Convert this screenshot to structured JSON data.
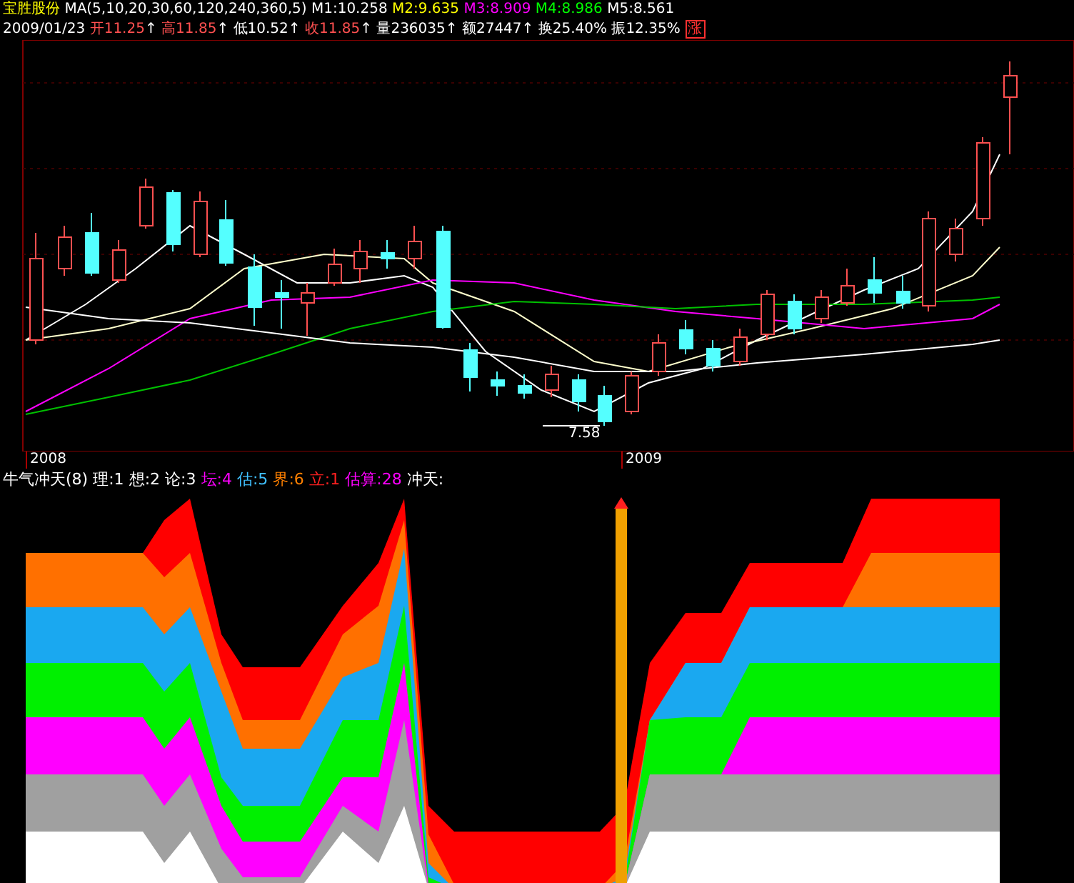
{
  "header": {
    "stock_name": "宝胜股份",
    "ma_params": "MA(5,10,20,30,60,120,240,360,5)",
    "ma_values": [
      {
        "label": "M1:10.258",
        "color": "#ffffff"
      },
      {
        "label": "M2:9.635",
        "color": "#ffff00"
      },
      {
        "label": "M3:8.909",
        "color": "#ff00ff"
      },
      {
        "label": "M4:8.986",
        "color": "#00ff00"
      },
      {
        "label": "M5:8.561",
        "color": "#ffffff"
      }
    ]
  },
  "quote": {
    "date": "2009/01/23",
    "fields": [
      {
        "label": "开11.25",
        "arrow": "↑",
        "color": "#ff5050"
      },
      {
        "label": "高11.85",
        "arrow": "↑",
        "color": "#ff5050"
      },
      {
        "label": "低10.52",
        "arrow": "↑",
        "color": "#ffffff"
      },
      {
        "label": "收11.85",
        "arrow": "↑",
        "color": "#ff5050"
      },
      {
        "label": "量236035",
        "arrow": "↑",
        "color": "#ffffff"
      },
      {
        "label": "额27447",
        "arrow": "↑",
        "color": "#ffffff"
      },
      {
        "label": "换25.40%",
        "color": "#ffffff"
      },
      {
        "label": "振12.35%",
        "color": "#ffffff"
      }
    ],
    "badge": "涨"
  },
  "price_chart": {
    "low_label": "7.58"
  },
  "time_axis": [
    {
      "label": "2008"
    },
    {
      "label": "2009"
    }
  ],
  "indicator": {
    "title": "牛气冲天(8)",
    "values": [
      {
        "label": "理:1",
        "color": "#ffffff"
      },
      {
        "label": "想:2",
        "color": "#ffffff"
      },
      {
        "label": "论:3",
        "color": "#ffffff"
      },
      {
        "label": "坛:4",
        "color": "#ff00ff"
      },
      {
        "label": "估:5",
        "color": "#40c0ff"
      },
      {
        "label": "界:6",
        "color": "#ff8000"
      },
      {
        "label": "立:1",
        "color": "#ff2020"
      },
      {
        "label": "估算:28",
        "color": "#ff00ff"
      },
      {
        "label": "冲天:",
        "color": "#ffffff"
      }
    ]
  }
}
